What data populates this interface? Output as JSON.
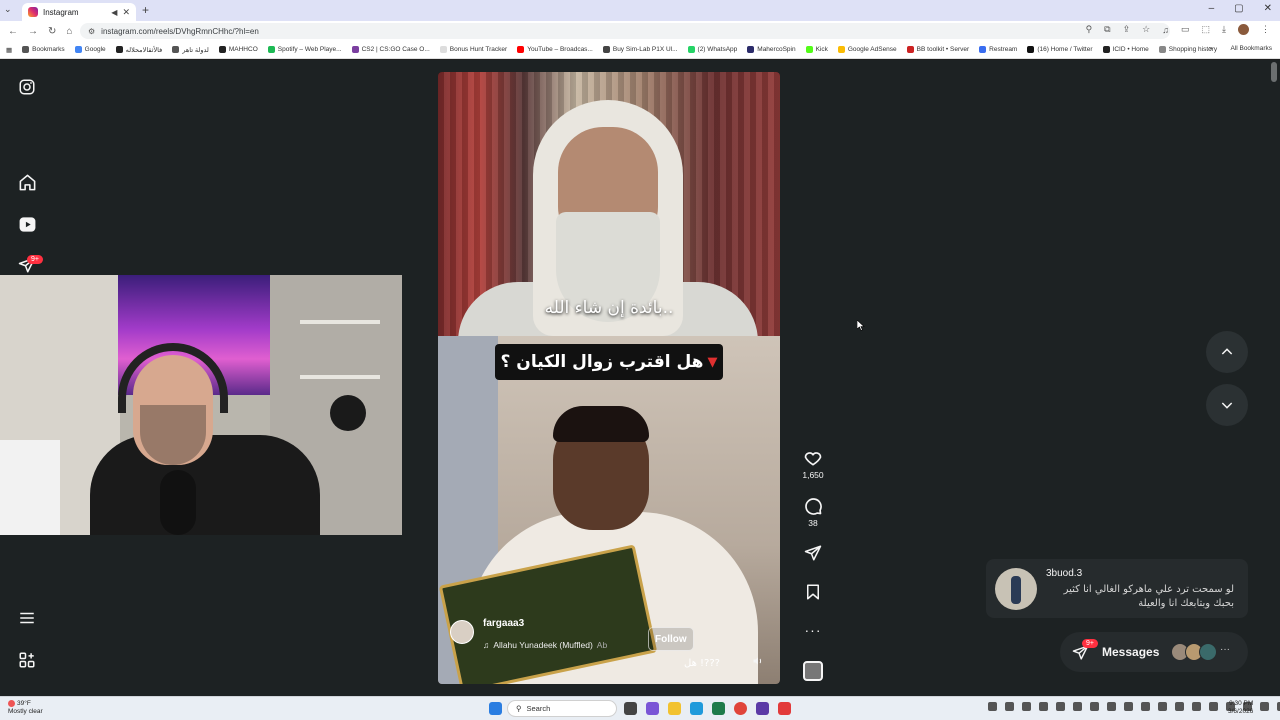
{
  "browser": {
    "tab_title": "Instagram",
    "url": "instagram.com/reels/DVhgRmnCHhc/?hl=en",
    "bookmarks": [
      {
        "label": "Bookmarks",
        "color": "#555555"
      },
      {
        "label": "Google",
        "color": "#4285f4"
      },
      {
        "label": "فالأثقالامحلاله",
        "color": "#222222"
      },
      {
        "label": "لدولة تاهر",
        "color": "#555555"
      },
      {
        "label": "MAHHCO",
        "color": "#222222"
      },
      {
        "label": "Spotify – Web Playe...",
        "color": "#1db954"
      },
      {
        "label": "CS2 | CS:GO Case O...",
        "color": "#7b3fa0"
      },
      {
        "label": "Bonus Hunt Tracker",
        "color": "#dddddd"
      },
      {
        "label": "YouTube – Broadcas...",
        "color": "#ff0000"
      },
      {
        "label": "Buy Sim-Lab P1X Ul...",
        "color": "#444444"
      },
      {
        "label": "(2) WhatsApp",
        "color": "#25d366"
      },
      {
        "label": "MahercoSpin",
        "color": "#2c2c6a"
      },
      {
        "label": "Kick",
        "color": "#53fc18"
      },
      {
        "label": "Google AdSense",
        "color": "#fbbc04"
      },
      {
        "label": "BB toolkit • Server",
        "color": "#cc2222"
      },
      {
        "label": "Restream",
        "color": "#3a6df0"
      },
      {
        "label": "(16) Home / Twitter",
        "color": "#111111"
      },
      {
        "label": "ICID • Home",
        "color": "#222222"
      },
      {
        "label": "Shopping history",
        "color": "#888888"
      }
    ],
    "all_bookmarks_label": "All Bookmarks"
  },
  "sidebar": {
    "notifications_badge": "9+"
  },
  "reel": {
    "subtitle_top": "بائدة إن شاء الله..",
    "question_overlay": "هل اقترب زوال الكيان ؟",
    "author": "fargaaa3",
    "music": "Allahu Yunadeek (Muffled)",
    "music_suffix": "Ab",
    "follow_label": "Follow",
    "caption": "هل !???",
    "likes": "1,650",
    "comments": "38"
  },
  "toast": {
    "username": "3buod.3",
    "message": "لو سمحت ترد علي ماهركو الغالي انا كثير بحبك وبتابعك انا والعيلة"
  },
  "messages": {
    "label": "Messages",
    "badge": "9+",
    "more": "···"
  },
  "taskbar": {
    "weather_temp": "39°F",
    "weather_desc": "Mostly clear",
    "search_label": "Search",
    "time": "9:30 PM",
    "date": "3/6/2026"
  },
  "colors": {
    "page_bg": "#1d2223",
    "badge_red": "#ff3040"
  }
}
